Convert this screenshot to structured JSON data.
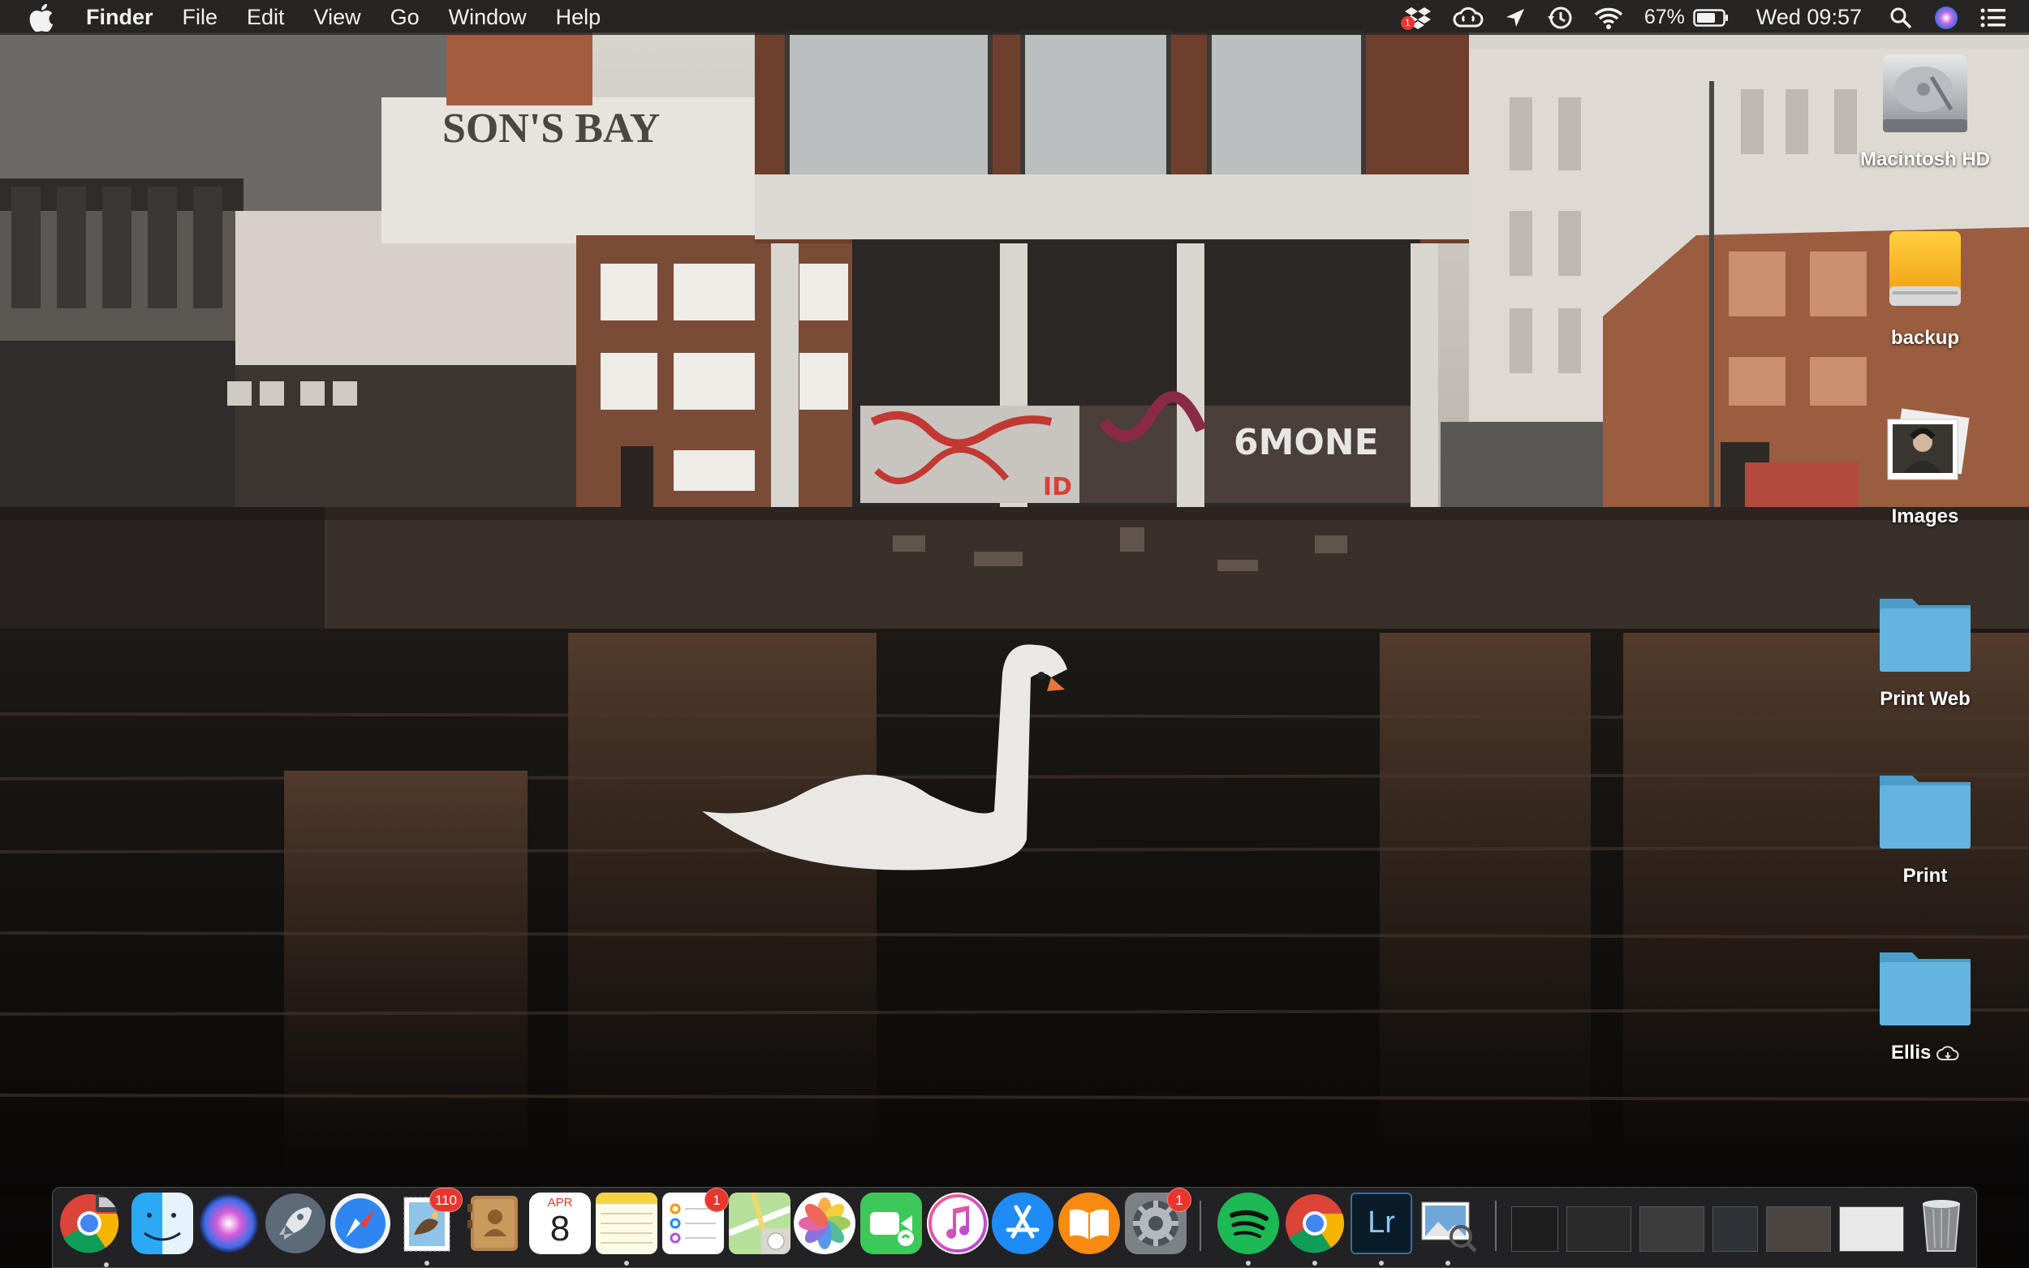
{
  "menubar": {
    "app_name": "Finder",
    "menus": [
      "File",
      "Edit",
      "View",
      "Go",
      "Window",
      "Help"
    ],
    "dropbox_badge": "1",
    "battery_percent": "67%",
    "clock": "Wed 09:57",
    "icons": [
      "apple-icon",
      "dropbox-icon",
      "creative-cloud-icon",
      "location-arrow-icon",
      "time-machine-icon",
      "wifi-icon",
      "battery-icon",
      "spotlight-search-icon",
      "siri-icon",
      "notification-center-icon"
    ]
  },
  "wallpaper": {
    "sign_text": "SON'S BAY",
    "graffiti_text": "6MONE",
    "graffiti_small": "ID"
  },
  "desktop_icons": [
    {
      "label": "Macintosh HD",
      "icon": "hard-drive-icon"
    },
    {
      "label": "backup",
      "icon": "external-drive-icon"
    },
    {
      "label": "Images",
      "icon": "photo-stack-icon"
    },
    {
      "label": "Print Web",
      "icon": "folder-icon"
    },
    {
      "label": "Print",
      "icon": "folder-icon"
    },
    {
      "label": "Ellis",
      "icon": "folder-icon",
      "suffix_icon": "icloud-download-icon"
    }
  ],
  "dock": {
    "apps": [
      {
        "name": "chrome-remote",
        "icon": "chrome-icon"
      },
      {
        "name": "finder",
        "icon": "finder-icon"
      },
      {
        "name": "siri",
        "icon": "siri-icon"
      },
      {
        "name": "launchpad",
        "icon": "rocket-icon"
      },
      {
        "name": "safari",
        "icon": "compass-icon"
      },
      {
        "name": "mail",
        "icon": "stamp-icon",
        "badge": "110"
      },
      {
        "name": "contacts",
        "icon": "address-book-icon"
      },
      {
        "name": "calendar",
        "icon": "calendar-icon",
        "month": "APR",
        "day": "8"
      },
      {
        "name": "notes",
        "icon": "notes-icon"
      },
      {
        "name": "reminders",
        "icon": "reminders-icon",
        "badge": "1"
      },
      {
        "name": "maps",
        "icon": "map-icon"
      },
      {
        "name": "photos",
        "icon": "photos-flower-icon"
      },
      {
        "name": "facetime",
        "icon": "video-camera-icon"
      },
      {
        "name": "itunes",
        "icon": "music-note-icon"
      },
      {
        "name": "app-store",
        "icon": "app-store-icon"
      },
      {
        "name": "ibooks",
        "icon": "book-icon"
      },
      {
        "name": "system-preferences",
        "icon": "gear-icon",
        "badge": "1"
      },
      {
        "name": "spotify",
        "icon": "spotify-icon"
      },
      {
        "name": "chrome",
        "icon": "chrome-icon"
      },
      {
        "name": "lightroom",
        "icon": "lightroom-icon",
        "text": "Lr"
      },
      {
        "name": "preview",
        "icon": "preview-icon"
      }
    ],
    "trash": {
      "icon": "trash-icon"
    }
  },
  "colors": {
    "menubar_bg": "#2a2826",
    "folder_blue": "#5fb3dc",
    "badge_red": "#e8362d",
    "spotify_green": "#1db954",
    "drive_orange": "#f5a623"
  }
}
